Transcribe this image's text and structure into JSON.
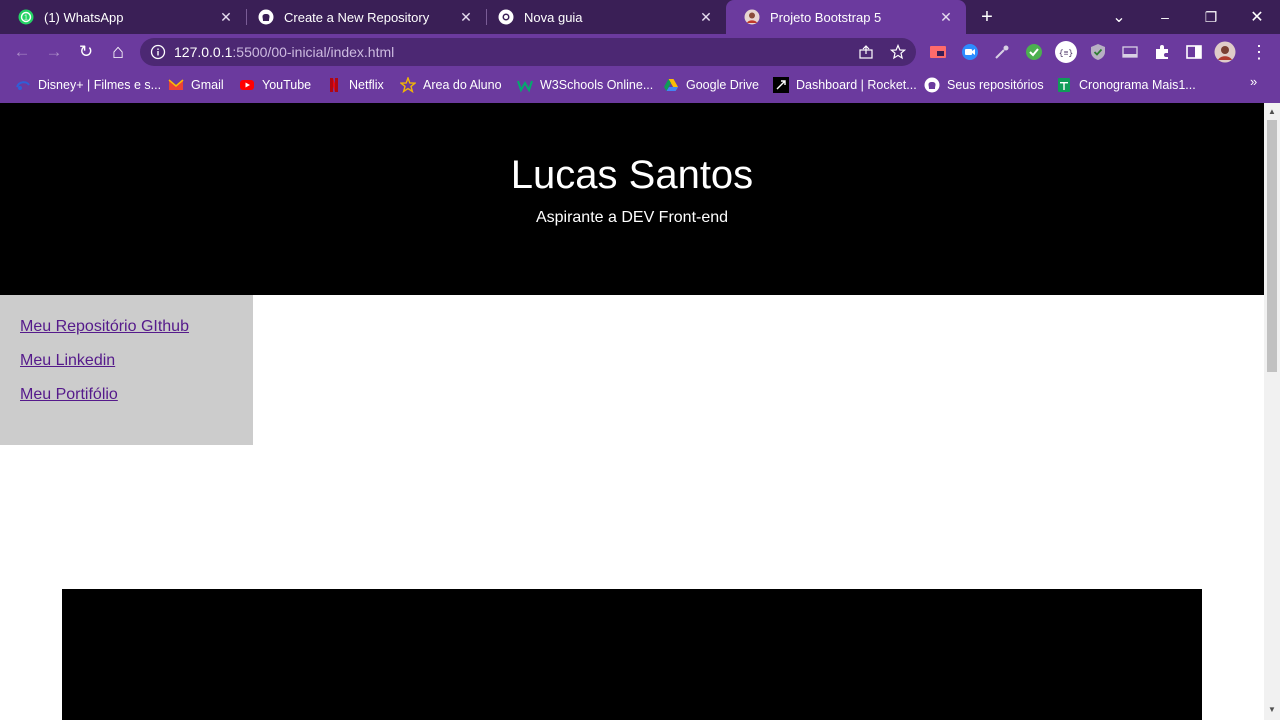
{
  "tabs": [
    {
      "title": "(1) WhatsApp",
      "icon": "whatsapp-icon",
      "active": false
    },
    {
      "title": "Create a New Repository",
      "icon": "github-icon",
      "active": false
    },
    {
      "title": "Nova guia",
      "icon": "chrome-icon",
      "active": false
    },
    {
      "title": "Projeto Bootstrap 5",
      "icon": "avatar-icon",
      "active": true
    }
  ],
  "window": {
    "minimize": "–",
    "restore": "❐",
    "close": "✕",
    "new_tab": "+",
    "tab_search": "⌄",
    "tab_close": "✕"
  },
  "toolbar": {
    "back": "←",
    "forward": "→",
    "reload": "↻",
    "home": "⌂",
    "url_host": "127.0.0.1",
    "url_path": ":5500/00-inicial/index.html",
    "menu": "⋮"
  },
  "bookmarks": [
    {
      "label": "Disney+ | Filmes e s...",
      "icon": "disney-icon",
      "color": "#1d3fb8"
    },
    {
      "label": "Gmail",
      "icon": "gmail-icon",
      "color": "#ea4335"
    },
    {
      "label": "YouTube",
      "icon": "youtube-icon",
      "color": "#ff0000"
    },
    {
      "label": "Netflix",
      "icon": "netflix-icon",
      "color": "#e50914"
    },
    {
      "label": "Area do Aluno",
      "icon": "star-icon",
      "color": "#f2b705"
    },
    {
      "label": "W3Schools Online...",
      "icon": "w3schools-icon",
      "color": "#04aa6d"
    },
    {
      "label": "Google Drive",
      "icon": "google-drive-icon",
      "color": "#fbbc04"
    },
    {
      "label": "Dashboard | Rocket...",
      "icon": "rocketseat-icon",
      "color": "#000000"
    },
    {
      "label": "Seus repositórios",
      "icon": "github-icon",
      "color": "#ffffff"
    },
    {
      "label": "Cronograma Mais1...",
      "icon": "sheets-icon",
      "color": "#0f9d58"
    }
  ],
  "bookmarks_overflow": "»",
  "page": {
    "name": "Lucas Santos",
    "subtitle": "Aspirante a DEV Front-end",
    "links": [
      "Meu Repositório GIthub",
      "Meu Linkedin",
      "Meu Portifólio"
    ]
  },
  "colors": {
    "tabstrip": "#3a1f56",
    "toolbar": "#6b3a9e",
    "omnibox": "#4c2873",
    "sidebar": "#cccccc",
    "link": "#551a8b"
  }
}
